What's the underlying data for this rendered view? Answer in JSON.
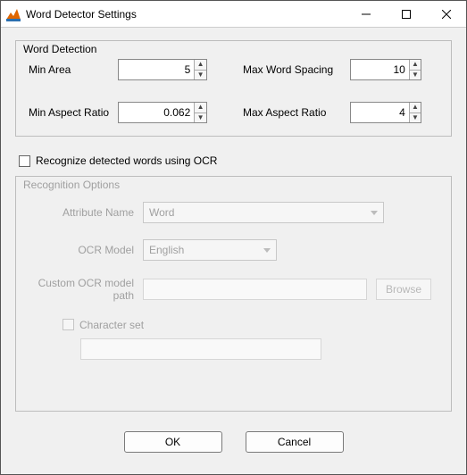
{
  "window": {
    "title": "Word Detector Settings"
  },
  "word_detection": {
    "legend": "Word Detection",
    "min_area_label": "Min Area",
    "min_area_value": "5",
    "max_word_spacing_label": "Max Word Spacing",
    "max_word_spacing_value": "10",
    "min_aspect_ratio_label": "Min Aspect Ratio",
    "min_aspect_ratio_value": "0.062",
    "max_aspect_ratio_label": "Max Aspect Ratio",
    "max_aspect_ratio_value": "4"
  },
  "ocr_checkbox_label": "Recognize detected words using OCR",
  "recognition_options": {
    "legend": "Recognition Options",
    "attribute_name_label": "Attribute Name",
    "attribute_name_value": "Word",
    "ocr_model_label": "OCR Model",
    "ocr_model_value": "English",
    "custom_path_label": "Custom OCR model path",
    "browse_label": "Browse",
    "charset_label": "Character set"
  },
  "footer": {
    "ok": "OK",
    "cancel": "Cancel"
  }
}
